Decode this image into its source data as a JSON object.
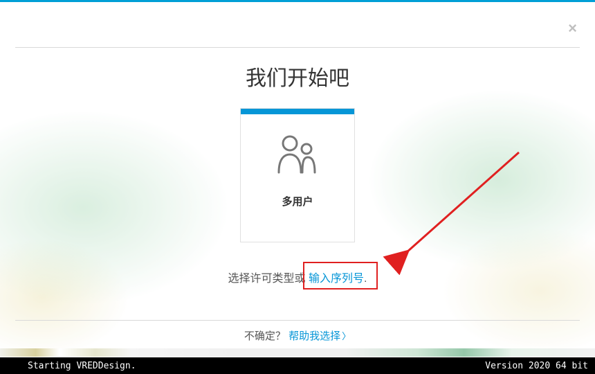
{
  "title": "我们开始吧",
  "card": {
    "label": "多用户"
  },
  "prompt": {
    "prefix": "选择许可类型或 ",
    "link": "输入序列号",
    "suffix": "."
  },
  "footer": {
    "prefix": "不确定？",
    "link": "帮助我选择"
  },
  "status": {
    "left": "Starting VREDDesign.",
    "right": "Version 2020  64 bit"
  },
  "colors": {
    "accent": "#0696d7",
    "topbar": "#009fd6",
    "highlight": "#e02020"
  }
}
